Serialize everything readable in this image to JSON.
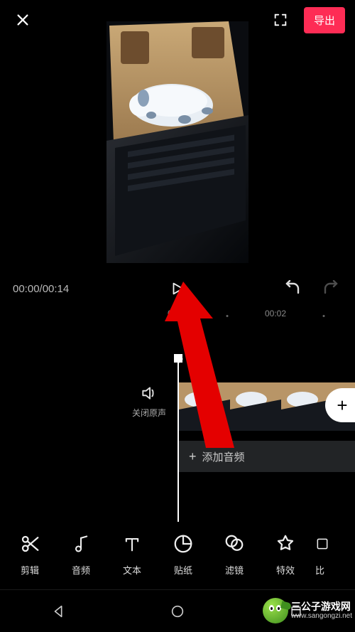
{
  "topbar": {
    "export_label": "导出"
  },
  "playback": {
    "current": "00:00",
    "total": "00:14",
    "display": "00:00/00:14"
  },
  "ruler": {
    "t0": "00:00",
    "t1": "00:02"
  },
  "mute": {
    "label": "关闭原声"
  },
  "audio_track": {
    "label": "添加音频",
    "plus": "+"
  },
  "add_clip": {
    "plus": "+"
  },
  "toolbar": {
    "items": [
      {
        "label": "剪辑",
        "icon": "scissors"
      },
      {
        "label": "音频",
        "icon": "music-note"
      },
      {
        "label": "文本",
        "icon": "text"
      },
      {
        "label": "贴纸",
        "icon": "sticker"
      },
      {
        "label": "滤镜",
        "icon": "filter-rings"
      },
      {
        "label": "特效",
        "icon": "sparkle-star"
      },
      {
        "label": "比",
        "icon": "aspect"
      }
    ]
  },
  "watermark": {
    "name": "三公子游戏网",
    "url": "www.sangongzi.net"
  },
  "colors": {
    "accent": "#fe2c55",
    "arrow": "#e40000"
  }
}
